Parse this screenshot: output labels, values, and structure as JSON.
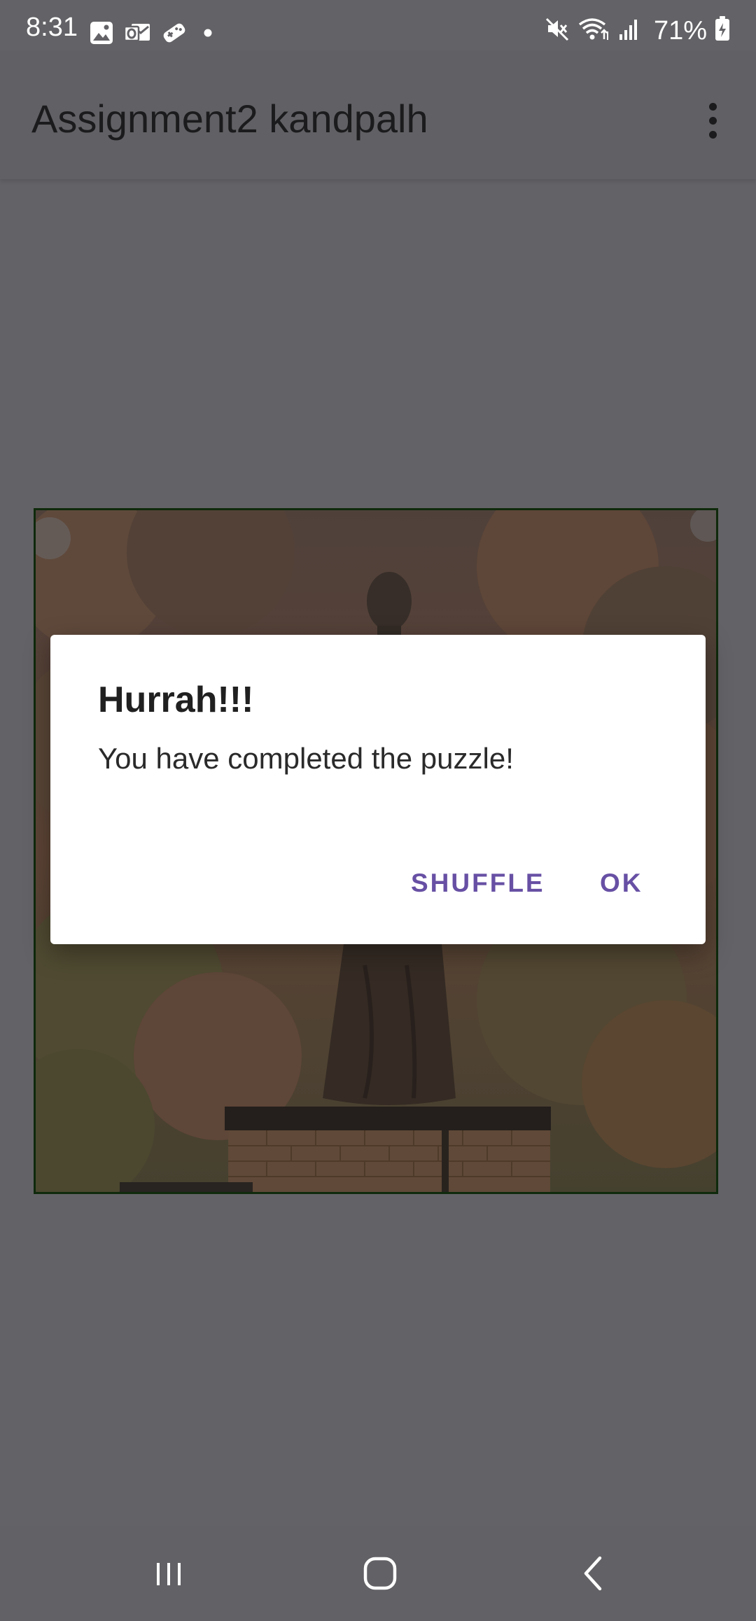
{
  "status_bar": {
    "time": "8:31",
    "battery_text": "71%",
    "left_icons": [
      "gallery-icon",
      "outlook-icon",
      "game-controller-icon",
      "notification-dot-icon"
    ],
    "right_icons": [
      "mute-icon",
      "wifi-icon",
      "signal-icon",
      "battery-charging-icon"
    ]
  },
  "app_bar": {
    "title": "Assignment2 kandpalh",
    "overflow_icon": "more-vert-icon"
  },
  "puzzle": {
    "image_description_icon": "statue-puzzle-image",
    "border_color": "#0f2a0c"
  },
  "dialog": {
    "title": "Hurrah!!!",
    "message": "You have completed the puzzle!",
    "shuffle_label": "SHUFFLE",
    "ok_label": "OK",
    "accent_color": "#6750a4"
  },
  "nav_bar": {
    "recent_icon": "recent-apps-icon",
    "home_icon": "home-icon",
    "back_icon": "back-icon"
  },
  "colors": {
    "scrim": "#636266",
    "dialog_background": "#ffffff"
  }
}
